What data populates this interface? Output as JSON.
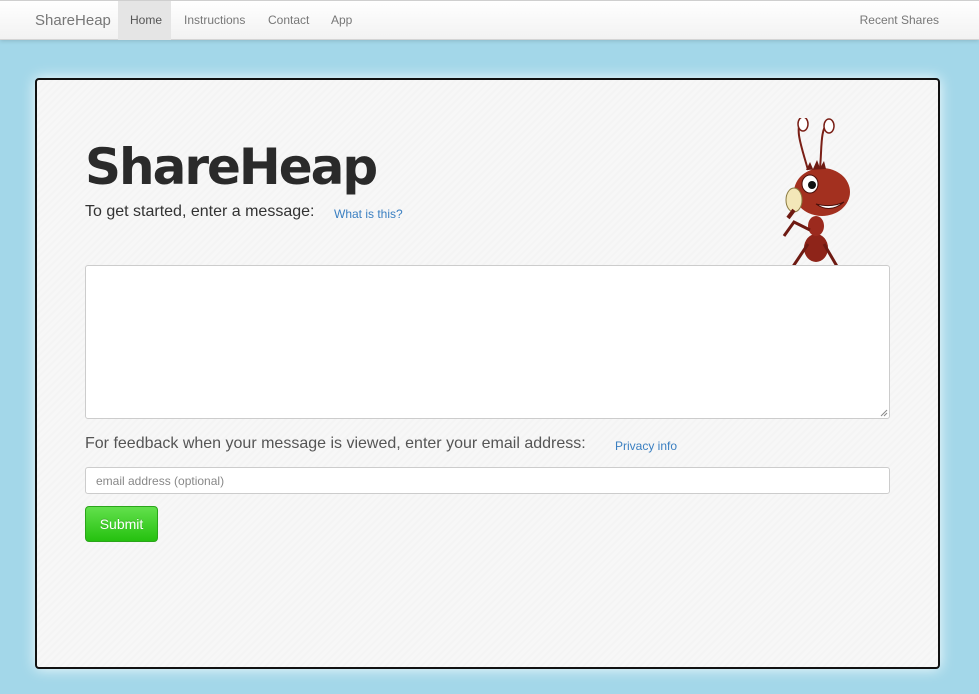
{
  "navbar": {
    "brand": "ShareHeap",
    "items": [
      {
        "label": "Home",
        "active": true
      },
      {
        "label": "Instructions"
      },
      {
        "label": "Contact"
      },
      {
        "label": "App"
      }
    ],
    "right_link": "Recent Shares"
  },
  "main": {
    "logo_text": "ShareHeap",
    "prompt": "To get started, enter a message:",
    "what_is_this_link": "What is this?",
    "message_value": "",
    "feedback_label": "For feedback when your message is viewed, enter your email address:",
    "privacy_link": "Privacy info",
    "email_placeholder": "email address (optional)",
    "email_value": "",
    "submit_label": "Submit"
  },
  "icons": {
    "mascot": "ant-mascot-icon",
    "resize": "resize-grip-icon"
  },
  "colors": {
    "page_background": "#a3d7e9",
    "link": "#3a7fc1",
    "submit_green": "#2fc91a",
    "mascot_red": "#9b2a1e"
  }
}
